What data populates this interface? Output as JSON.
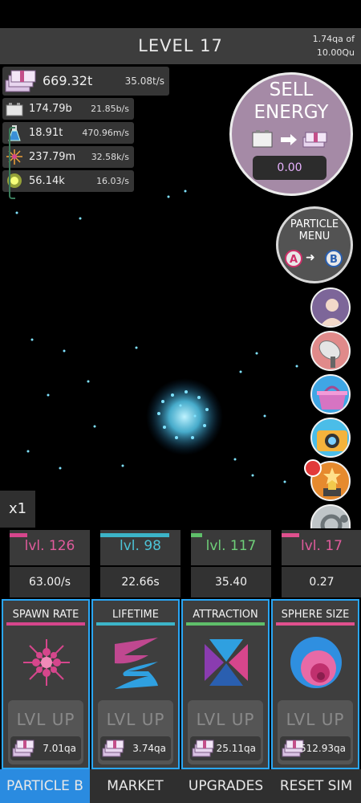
{
  "header": {
    "level_label": "LEVEL 17",
    "progress_current": "1.74qa of",
    "progress_target": "10.00Qu"
  },
  "resources": {
    "main": {
      "icon": "money-stack-icon",
      "amount": "669.32t",
      "rate": "35.08t/s"
    },
    "items": [
      {
        "icon": "battery-icon",
        "amount": "174.79b",
        "rate": "21.85b/s"
      },
      {
        "icon": "flask-icon",
        "amount": "18.91t",
        "rate": "470.96m/s"
      },
      {
        "icon": "sparkle-icon",
        "amount": "237.79m",
        "rate": "32.58k/s"
      },
      {
        "icon": "sun-icon",
        "amount": "56.14k",
        "rate": "16.03/s"
      }
    ]
  },
  "sell_energy": {
    "title_line1": "SELL",
    "title_line2": "ENERGY",
    "value": "0.00"
  },
  "particle_menu": {
    "title_line1": "PARTICLE",
    "title_line2": "MENU",
    "from": "A",
    "to": "B"
  },
  "side_buttons": [
    {
      "name": "profile-button",
      "icon": "profile-icon"
    },
    {
      "name": "satellite-button",
      "icon": "satellite-icon"
    },
    {
      "name": "shop-basket-button",
      "icon": "basket-icon"
    },
    {
      "name": "camera-button",
      "icon": "camera-icon"
    },
    {
      "name": "achievements-button",
      "icon": "trophy-icon"
    },
    {
      "name": "settings-button",
      "icon": "gear-icon"
    }
  ],
  "multiplier": "x1",
  "upgrades": [
    {
      "level": "lvl. 126",
      "value": "63.00/s",
      "title": "SPAWN RATE",
      "button": "LVL UP",
      "cost": "7.01qa",
      "color": "#d6468c"
    },
    {
      "level": "lvl. 98",
      "value": "22.66s",
      "title": "LIFETIME",
      "button": "LVL UP",
      "cost": "3.74qa",
      "color": "#3cb4c8"
    },
    {
      "level": "lvl. 117",
      "value": "35.40",
      "title": "ATTRACTION",
      "button": "LVL UP",
      "cost": "25.11qa",
      "color": "#5fbf6a"
    },
    {
      "level": "lvl. 17",
      "value": "0.27",
      "title": "SPHERE SIZE",
      "button": "LVL UP",
      "cost": "512.93qa",
      "color": "#e0508e"
    }
  ],
  "nav": {
    "tabs": [
      "PARTICLE B",
      "MARKET",
      "UPGRADES",
      "RESET SIM"
    ],
    "active": "PARTICLE B"
  },
  "colors": {
    "accent_blue": "#2a8be0",
    "sell_circle": "#a58aa6",
    "particle_glow": "#5fd8ff"
  }
}
